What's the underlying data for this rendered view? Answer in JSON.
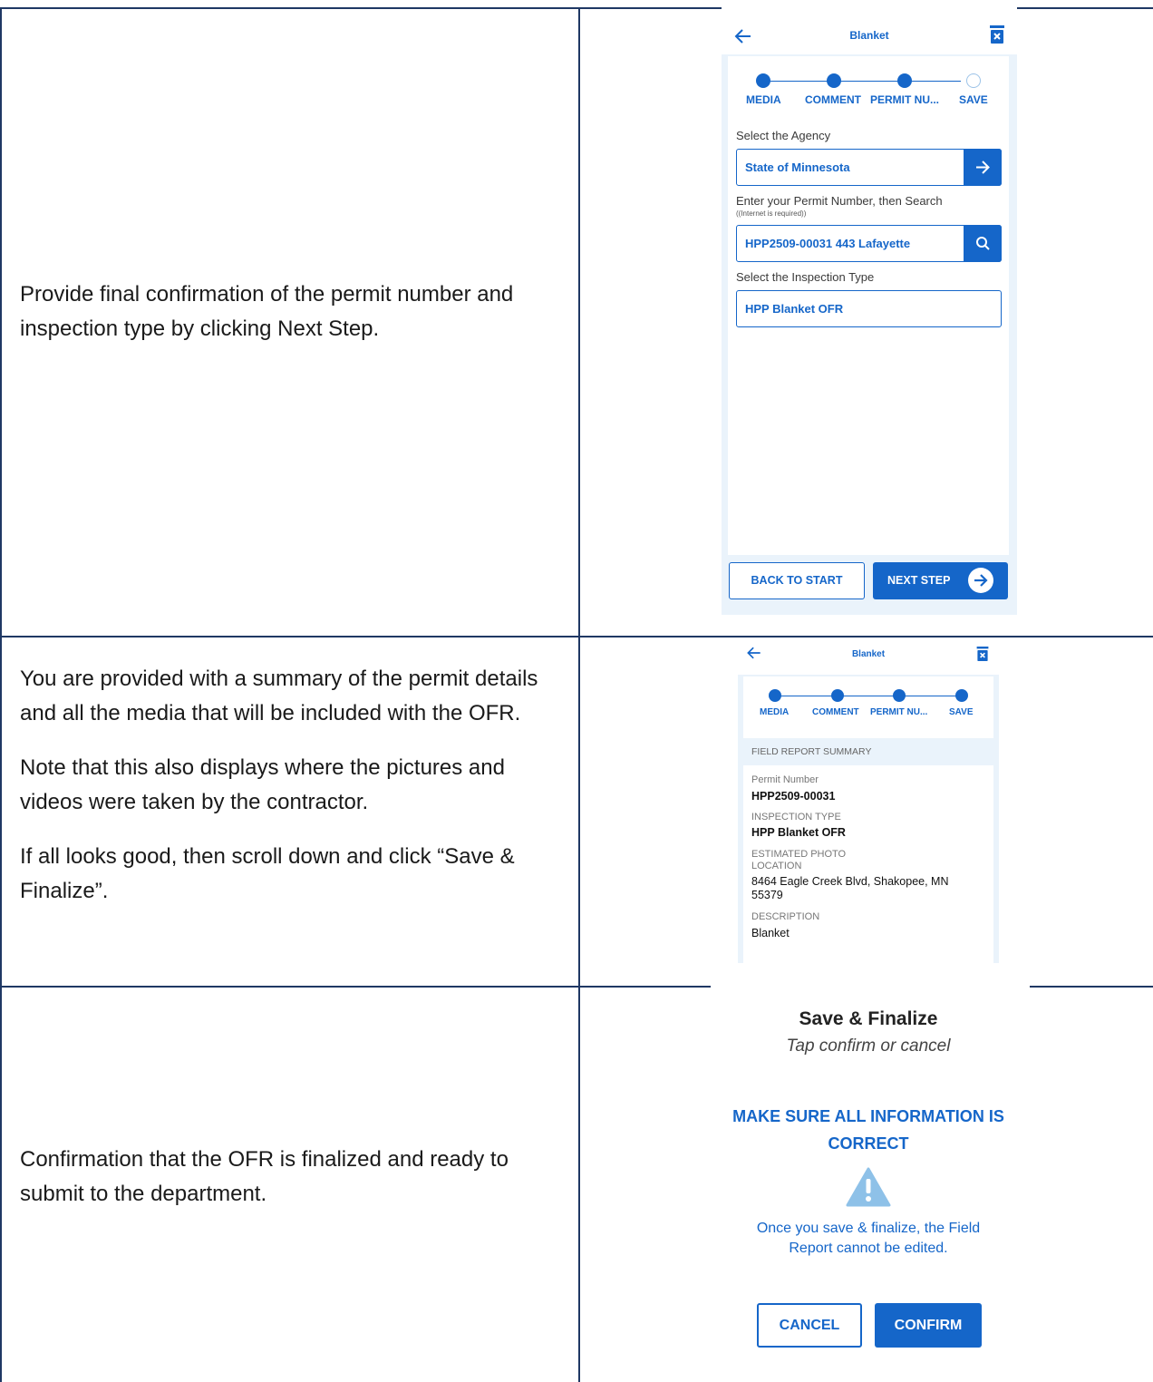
{
  "rows": [
    {
      "paragraphs": [
        "Provide final confirmation of the permit number and inspection type by clicking Next Step."
      ]
    },
    {
      "paragraphs": [
        "You are provided with a summary of the permit details and all the media that will be included with the OFR.",
        "Note that this also displays where the pictures and videos were taken by the contractor.",
        "If all looks good, then scroll down and click “Save & Finalize”."
      ]
    },
    {
      "paragraphs": [
        "Confirmation that the OFR is finalized and ready to submit to the department."
      ]
    }
  ],
  "screen1": {
    "title": "Blanket",
    "steps": [
      "MEDIA",
      "COMMENT",
      "PERMIT NU...",
      "SAVE"
    ],
    "agency_label": "Select the Agency",
    "agency_value": "State of Minnesota",
    "permit_label": "Enter your Permit Number, then Search",
    "permit_hint": "((Internet is required))",
    "permit_value": "HPP2509-00031 443 Lafayette",
    "inspection_label": "Select the Inspection Type",
    "inspection_value": "HPP Blanket OFR",
    "back_button": "BACK TO START",
    "next_button": "NEXT STEP"
  },
  "screen2": {
    "title": "Blanket",
    "steps": [
      "MEDIA",
      "COMMENT",
      "PERMIT NU...",
      "SAVE"
    ],
    "section_header": "FIELD REPORT SUMMARY",
    "permit_number_label": "Permit Number",
    "permit_number_value": "HPP2509-00031",
    "inspection_type_label": "INSPECTION TYPE",
    "inspection_type_value": "HPP Blanket OFR",
    "location_label_1": "ESTIMATED PHOTO",
    "location_label_2": "LOCATION",
    "location_value_1": "8464 Eagle Creek Blvd, Shakopee, MN",
    "location_value_2": "55379",
    "description_label": "DESCRIPTION",
    "description_value": "Blanket"
  },
  "screen3": {
    "title": "Save & Finalize",
    "subtitle": "Tap confirm or cancel",
    "warning_line_1": "MAKE SURE ALL INFORMATION IS",
    "warning_line_2": "CORRECT",
    "note_line_1": "Once you save & finalize, the Field",
    "note_line_2": "Report cannot be edited.",
    "cancel_button": "CANCEL",
    "confirm_button": "CONFIRM"
  },
  "colors": {
    "accent": "#1566c9",
    "border": "#1f3864",
    "panel": "#eaf3fb",
    "warning": "#8ec1e8"
  }
}
